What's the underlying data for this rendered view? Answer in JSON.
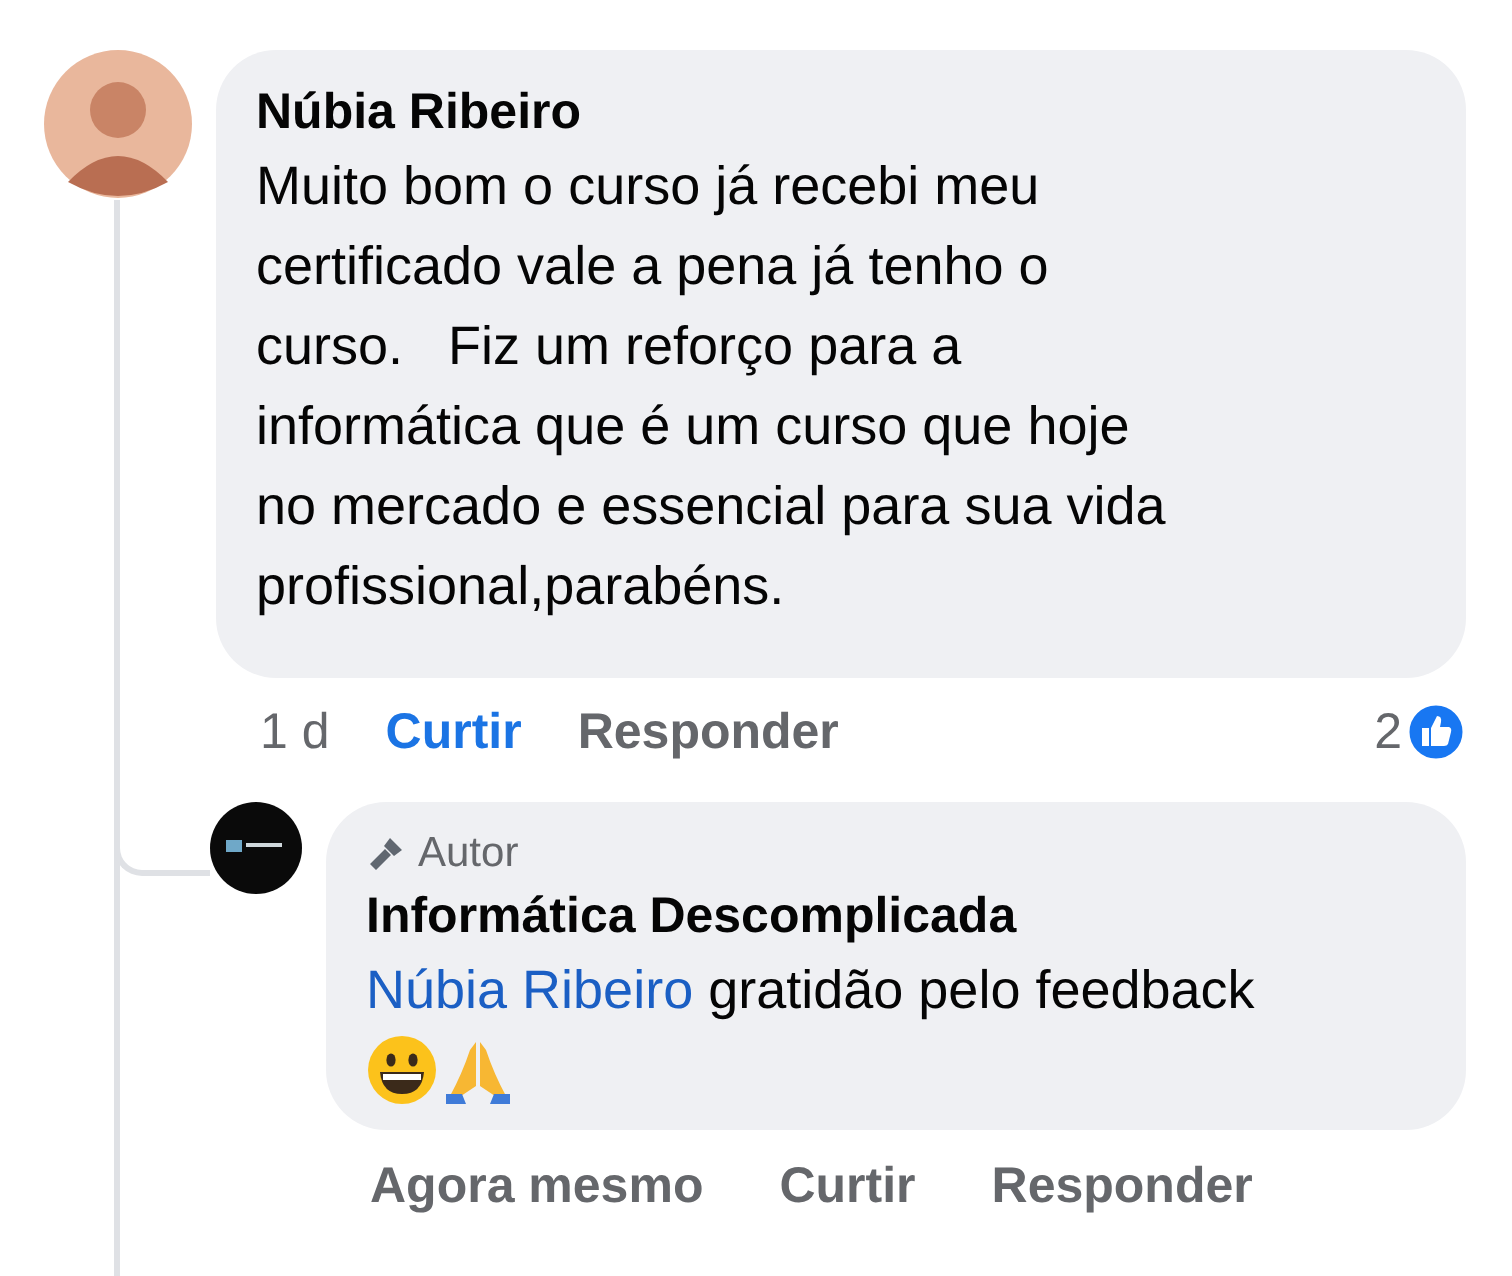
{
  "comment": {
    "author": "Núbia Ribeiro",
    "text_lines": [
      "Muito bom o curso já recebi meu",
      "certificado vale a pena já tenho o",
      "curso.   Fiz um reforço para a",
      "informática que é um curso que hoje",
      "no mercado e essencial para sua vida",
      "profissional,parabéns."
    ],
    "time": "1 d",
    "like_label": "Curtir",
    "liked": true,
    "reply_label": "Responder",
    "reaction_count": "2"
  },
  "reply": {
    "badge": "Autor",
    "author": "Informática Descomplicada",
    "mention": "Núbia Ribeiro",
    "text": "gratidão pelo feedback",
    "time": "Agora mesmo",
    "like_label": "Curtir",
    "liked": false,
    "reply_label": "Responder"
  }
}
